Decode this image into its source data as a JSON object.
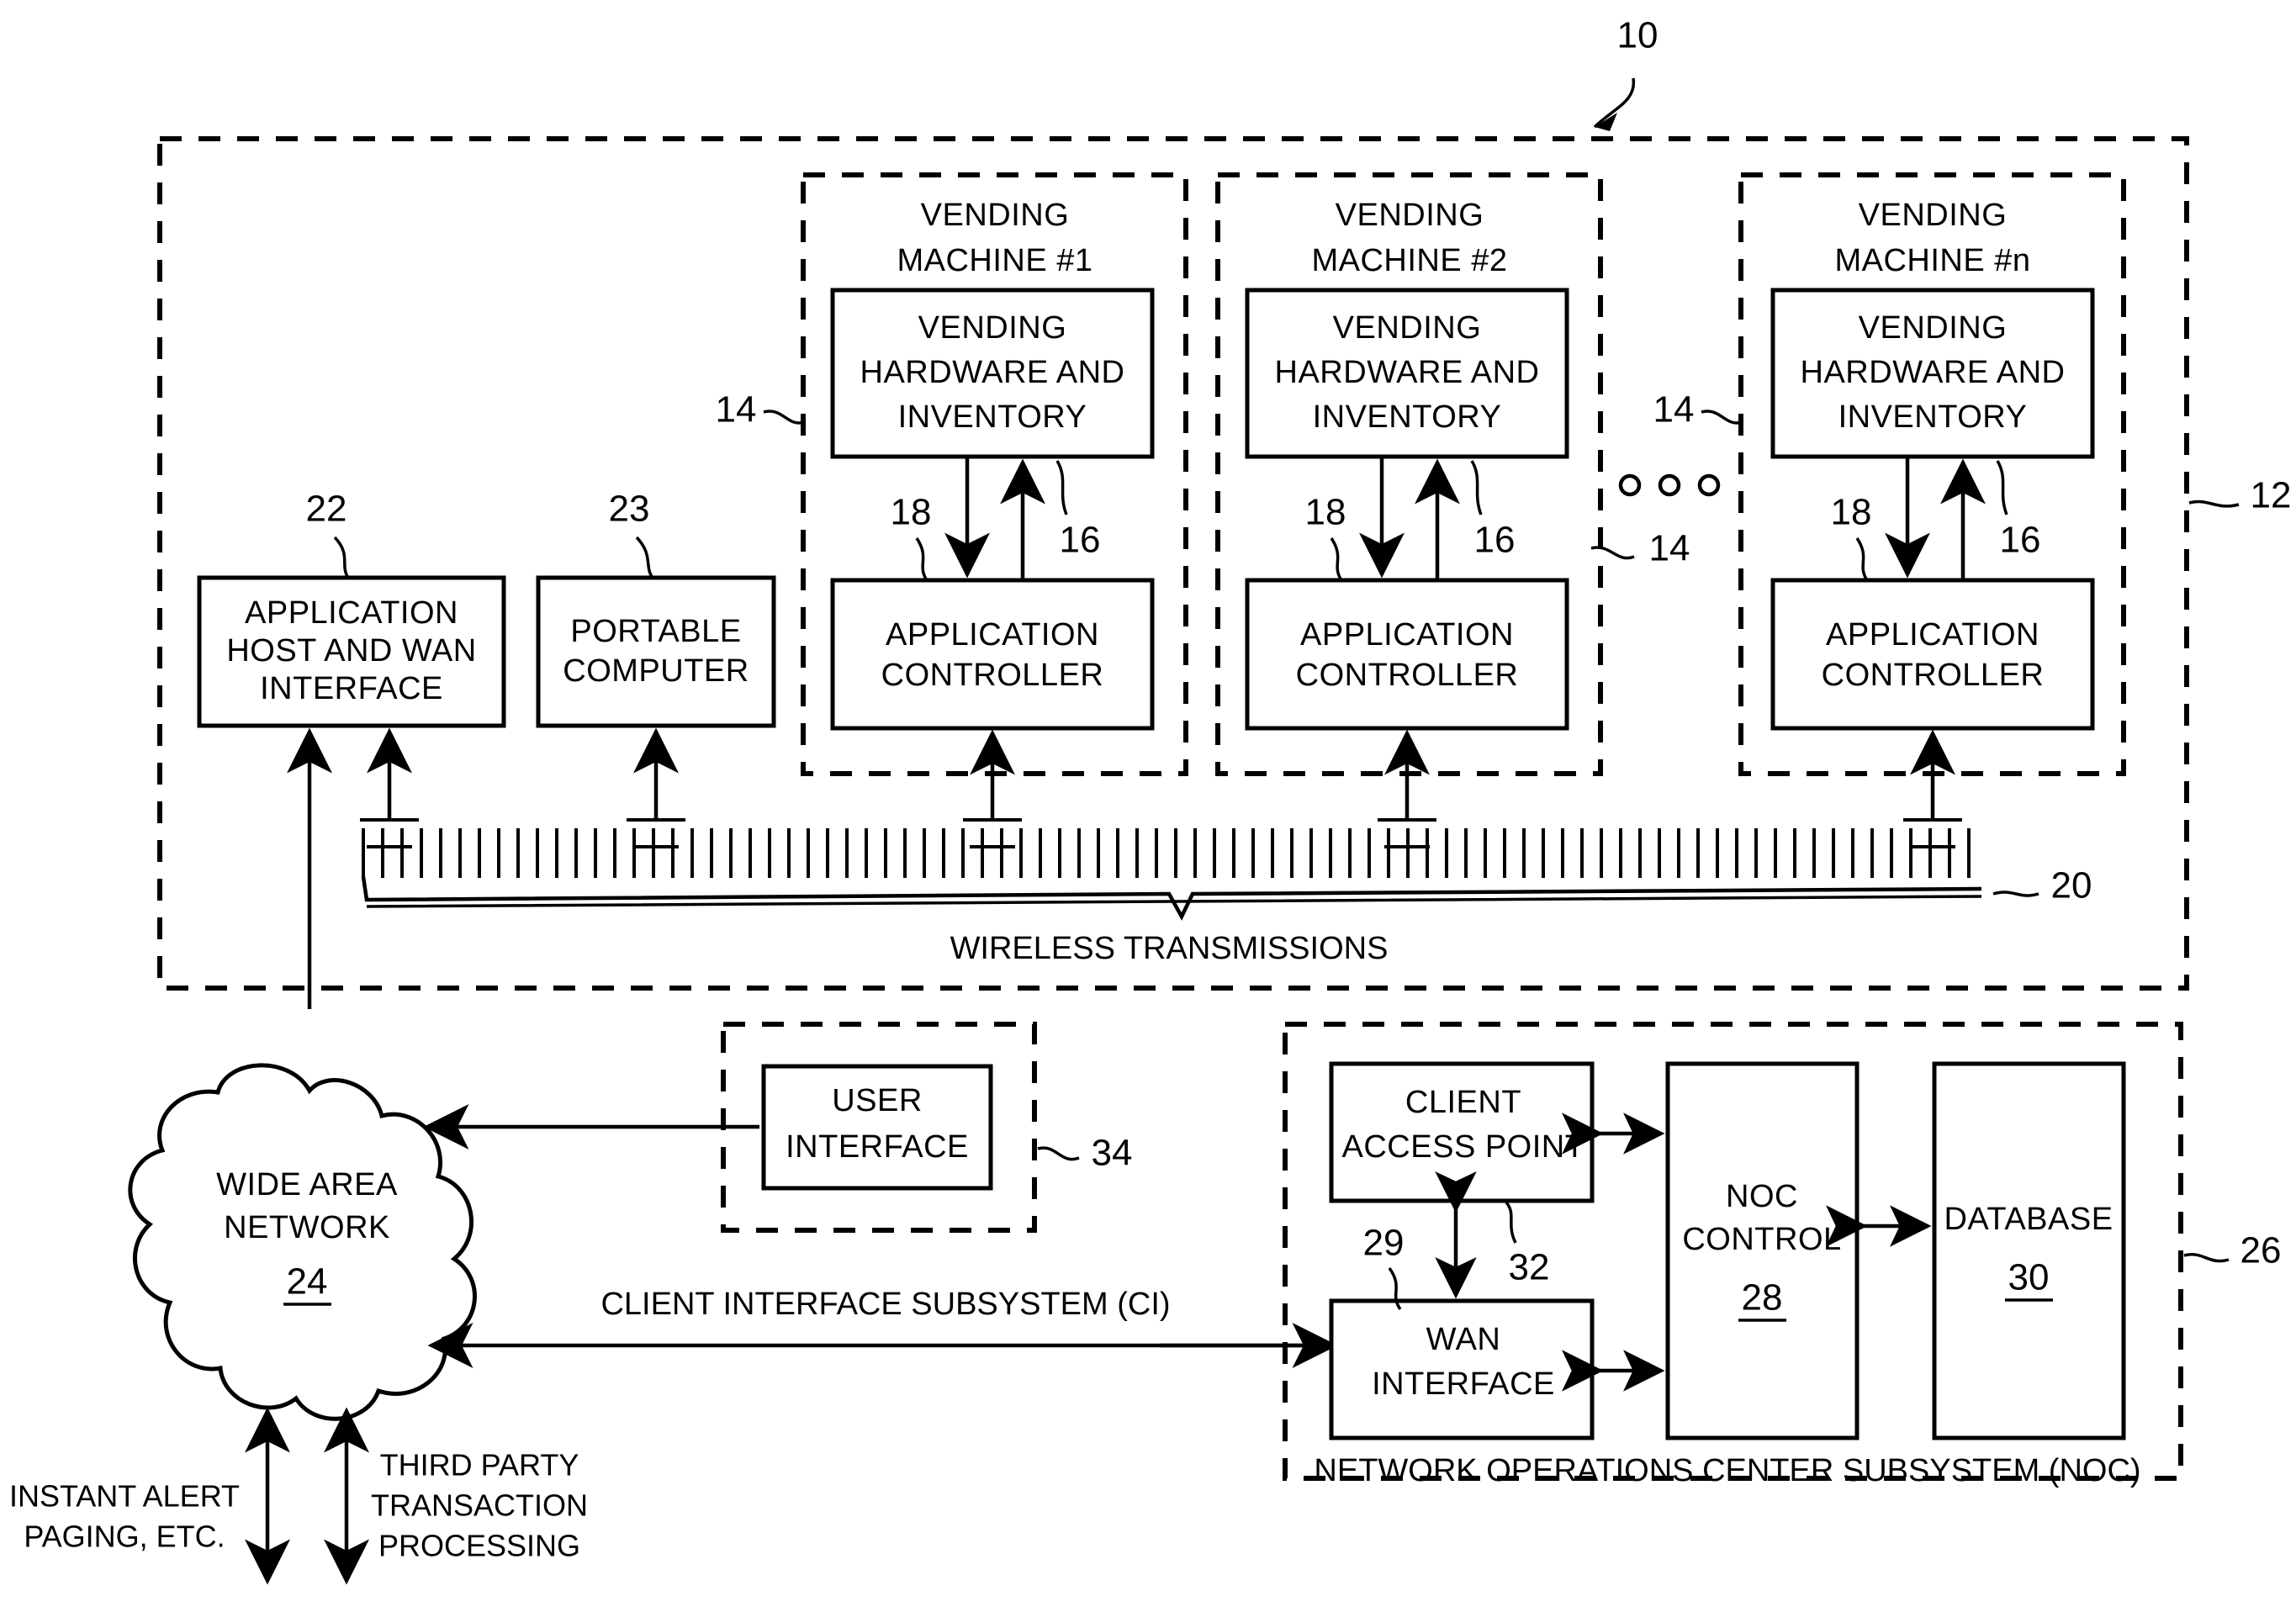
{
  "figure": {
    "type": "patent-block-diagram",
    "top_reference_number": "10",
    "outer_system_reference": "12",
    "wireless_reference": "20",
    "noc_reference": "26",
    "ui_reference": "34"
  },
  "wireless": {
    "label": "WIRELESS TRANSMISSIONS",
    "reference": "20"
  },
  "left_boxes": [
    {
      "ref": "22",
      "lines": [
        "APPLICATION",
        "HOST AND WAN",
        "INTERFACE"
      ]
    },
    {
      "ref": "23",
      "lines": [
        "PORTABLE",
        "COMPUTER"
      ]
    }
  ],
  "vending_machines": [
    {
      "title_line1": "VENDING",
      "title_line2": "MACHINE #1",
      "machine_ref": "14",
      "hardware": [
        "VENDING",
        "HARDWARE AND",
        "INVENTORY"
      ],
      "controller": [
        "APPLICATION",
        "CONTROLLER"
      ],
      "arrow_down_ref": "18",
      "arrow_up_ref": "16"
    },
    {
      "title_line1": "VENDING",
      "title_line2": "MACHINE #2",
      "machine_ref": "14",
      "hardware": [
        "VENDING",
        "HARDWARE AND",
        "INVENTORY"
      ],
      "controller": [
        "APPLICATION",
        "CONTROLLER"
      ],
      "arrow_down_ref": "18",
      "arrow_up_ref": "16"
    },
    {
      "title_line1": "VENDING",
      "title_line2": "MACHINE #n",
      "machine_ref": "14",
      "hardware": [
        "VENDING",
        "HARDWARE AND",
        "INVENTORY"
      ],
      "controller": [
        "APPLICATION",
        "CONTROLLER"
      ],
      "arrow_down_ref": "18",
      "arrow_up_ref": "16"
    }
  ],
  "ellipsis": "o o o",
  "cloud": {
    "line1": "WIDE AREA",
    "line2": "NETWORK",
    "ref": "24"
  },
  "user_interface": {
    "line1": "USER",
    "line2": "INTERFACE",
    "ref": "34"
  },
  "client_interface": {
    "label": "CLIENT INTERFACE SUBSYSTEM (CI)"
  },
  "noc": {
    "caption": "NETWORK OPERATIONS CENTER SUBSYSTEM (NOC)",
    "ref": "26",
    "client_access_point": {
      "line1": "CLIENT",
      "line2": "ACCESS POINT"
    },
    "wan_interface": {
      "line1": "WAN",
      "line2": "INTERFACE"
    },
    "noc_control": {
      "line1": "NOC",
      "line2": "CONTROL",
      "ref": "28"
    },
    "database": {
      "line1": "DATABASE",
      "ref": "30"
    },
    "link_ref_left": "29",
    "link_ref_right": "32"
  },
  "external_flows": [
    {
      "line1": "INSTANT ALERT",
      "line2": "PAGING, ETC."
    },
    {
      "line1": "THIRD PARTY",
      "line2": "TRANSACTION",
      "line3": "PROCESSING"
    }
  ],
  "colors": {
    "ink": "#000000",
    "paper": "#ffffff"
  }
}
